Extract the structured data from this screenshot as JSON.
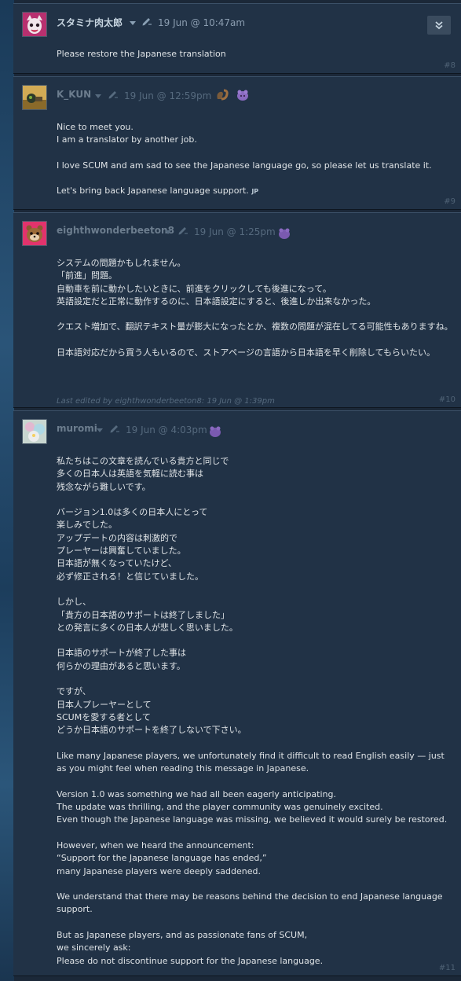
{
  "posts": [
    {
      "author": "スタミナ肉太郎",
      "date": "19 Jun @ 10:47am",
      "paragraphs": [
        "Please restore the Japanese translation"
      ],
      "number": "#8"
    },
    {
      "author": "K_KUN",
      "date": "19 Jun @ 12:59pm",
      "paragraphs": [
        "Nice to meet you.\nI am a translator by another job.",
        "I love SCUM and am sad to see the Japanese language go, so please let us translate it.",
        "Let's bring back Japanese language support."
      ],
      "lang_tag": "JP",
      "number": "#9"
    },
    {
      "author": "eighthwonderbeeton8",
      "date": "19 Jun @ 1:25pm",
      "paragraphs": [
        "システムの問題かもしれません。\n「前進」問題。\n自動車を前に動かしたいときに、前進をクリックしても後進になって。\n英語設定だと正常に動作するのに、日本語設定にすると、後進しか出来なかった。",
        "クエスト増加で、翻訳テキスト量が膨大になったとか、複数の問題が混在してる可能性もありますね。",
        "日本語対応だから買う人もいるので、ストアページの言語から日本語を早く削除してもらいたい。"
      ],
      "edited_label": "Last edited by",
      "edited_by": "eighthwonderbeeton8",
      "edited_date": "19 Jun @ 1:39pm",
      "number": "#10"
    },
    {
      "author": "muromi",
      "date": "19 Jun @ 4:03pm",
      "paragraphs": [
        "私たちはこの文章を読んでいる貴方と同じで\n多くの日本人は英語を気軽に読む事は\n残念ながら難しいです。",
        "バージョン1.0は多くの日本人にとって\n楽しみでした。\nアップデートの内容は刺激的で\nプレーヤーは興奮していました。\n日本語が無くなっていたけど、\n必ず修正される！と信じていました。",
        "しかし、\n「貴方の日本語のサポートは終了しました」\nとの発言に多くの日本人が悲しく思いました。",
        "日本語のサポートが終了した事は\n何らかの理由があると思います。",
        "ですが、\n日本人プレーヤーとして\nSCUMを愛する者として\nどうか日本語のサポートを終了しないで下さい。",
        "Like many Japanese players, we unfortunately find it difficult to read English easily — just as you might feel when reading this message in Japanese.",
        "Version 1.0 was something we had all been eagerly anticipating.\nThe update was thrilling, and the player community was genuinely excited.\nEven though the Japanese language was missing, we believed it would surely be restored.",
        "However, when we heard the announcement:\n“Support for the Japanese language has ended,”\nmany Japanese players were deeply saddened.",
        "We understand that there may be reasons behind the decision to end Japanese language support.",
        "But as Japanese players, and as passionate fans of SCUM,\nwe sincerely ask:\nPlease do not discontinue support for the Japanese language."
      ],
      "number": "#11"
    }
  ],
  "icons": {
    "expand": "double-chevron-down-icon",
    "edit": "pencil-icon",
    "caret": "dropdown-caret-icon"
  },
  "colors": {
    "page_bg": "#1b2838",
    "post_bg": "#213246",
    "author": "#c7d5e0",
    "text": "#dfe3e6",
    "muted": "#566a7e"
  }
}
